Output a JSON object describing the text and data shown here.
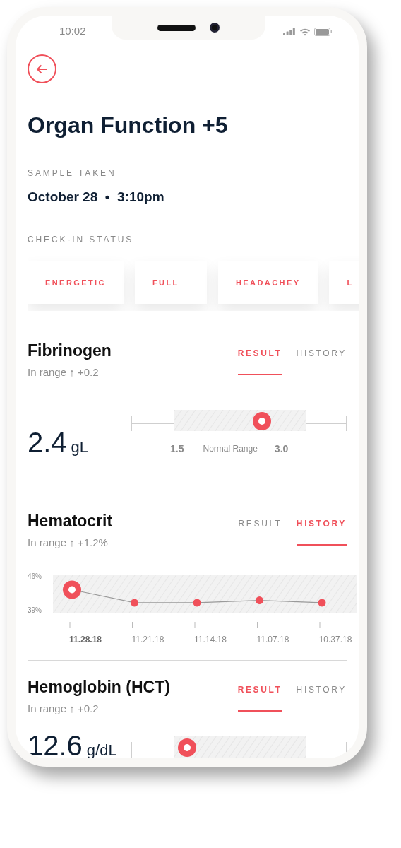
{
  "status_bar": {
    "time": "10:02"
  },
  "title": "Organ Function +5",
  "sample": {
    "label": "SAMPLE TAKEN",
    "value": "October 28  •  3:10pm"
  },
  "check_in": {
    "label": "CHECK-IN STATUS",
    "statuses": [
      "ENERGETIC",
      "FULL",
      "HEADACHEY",
      "L"
    ]
  },
  "metrics": [
    {
      "kind": "result",
      "name": "Fibrinogen",
      "status": "In range ↑ +0.2",
      "tabs": [
        {
          "label": "RESULT",
          "selected": true
        },
        {
          "label": "HISTORY",
          "selected": false
        }
      ],
      "value": "2.4",
      "unit": "gL",
      "range_low": "1.5",
      "range_label": "Normal Range",
      "range_high": "3.0"
    },
    {
      "kind": "history",
      "name": "Hematocrit",
      "status": "In range ↑ +1.2%",
      "tabs": [
        {
          "label": "RESULT",
          "selected": false
        },
        {
          "label": "HISTORY",
          "selected": true
        }
      ],
      "chart_data": {
        "type": "line",
        "categories": [
          "11.28.18",
          "11.21.18",
          "11.14.18",
          "11.07.18",
          "10.37.18"
        ],
        "values": [
          43.2,
          40.5,
          40.5,
          41,
          40.5
        ],
        "marker": "o",
        "ylim": [
          38.3,
          46.2
        ],
        "yticks": [
          {
            "value": 46,
            "label": "46%"
          },
          {
            "value": 39,
            "label": "39%"
          }
        ]
      }
    },
    {
      "kind": "result",
      "name": "Hemoglobin (HCT)",
      "status": "In range ↑ +0.2",
      "tabs": [
        {
          "label": "RESULT",
          "selected": true
        },
        {
          "label": "HISTORY",
          "selected": false
        }
      ],
      "value": "12.6",
      "unit": "g/dL"
    }
  ]
}
